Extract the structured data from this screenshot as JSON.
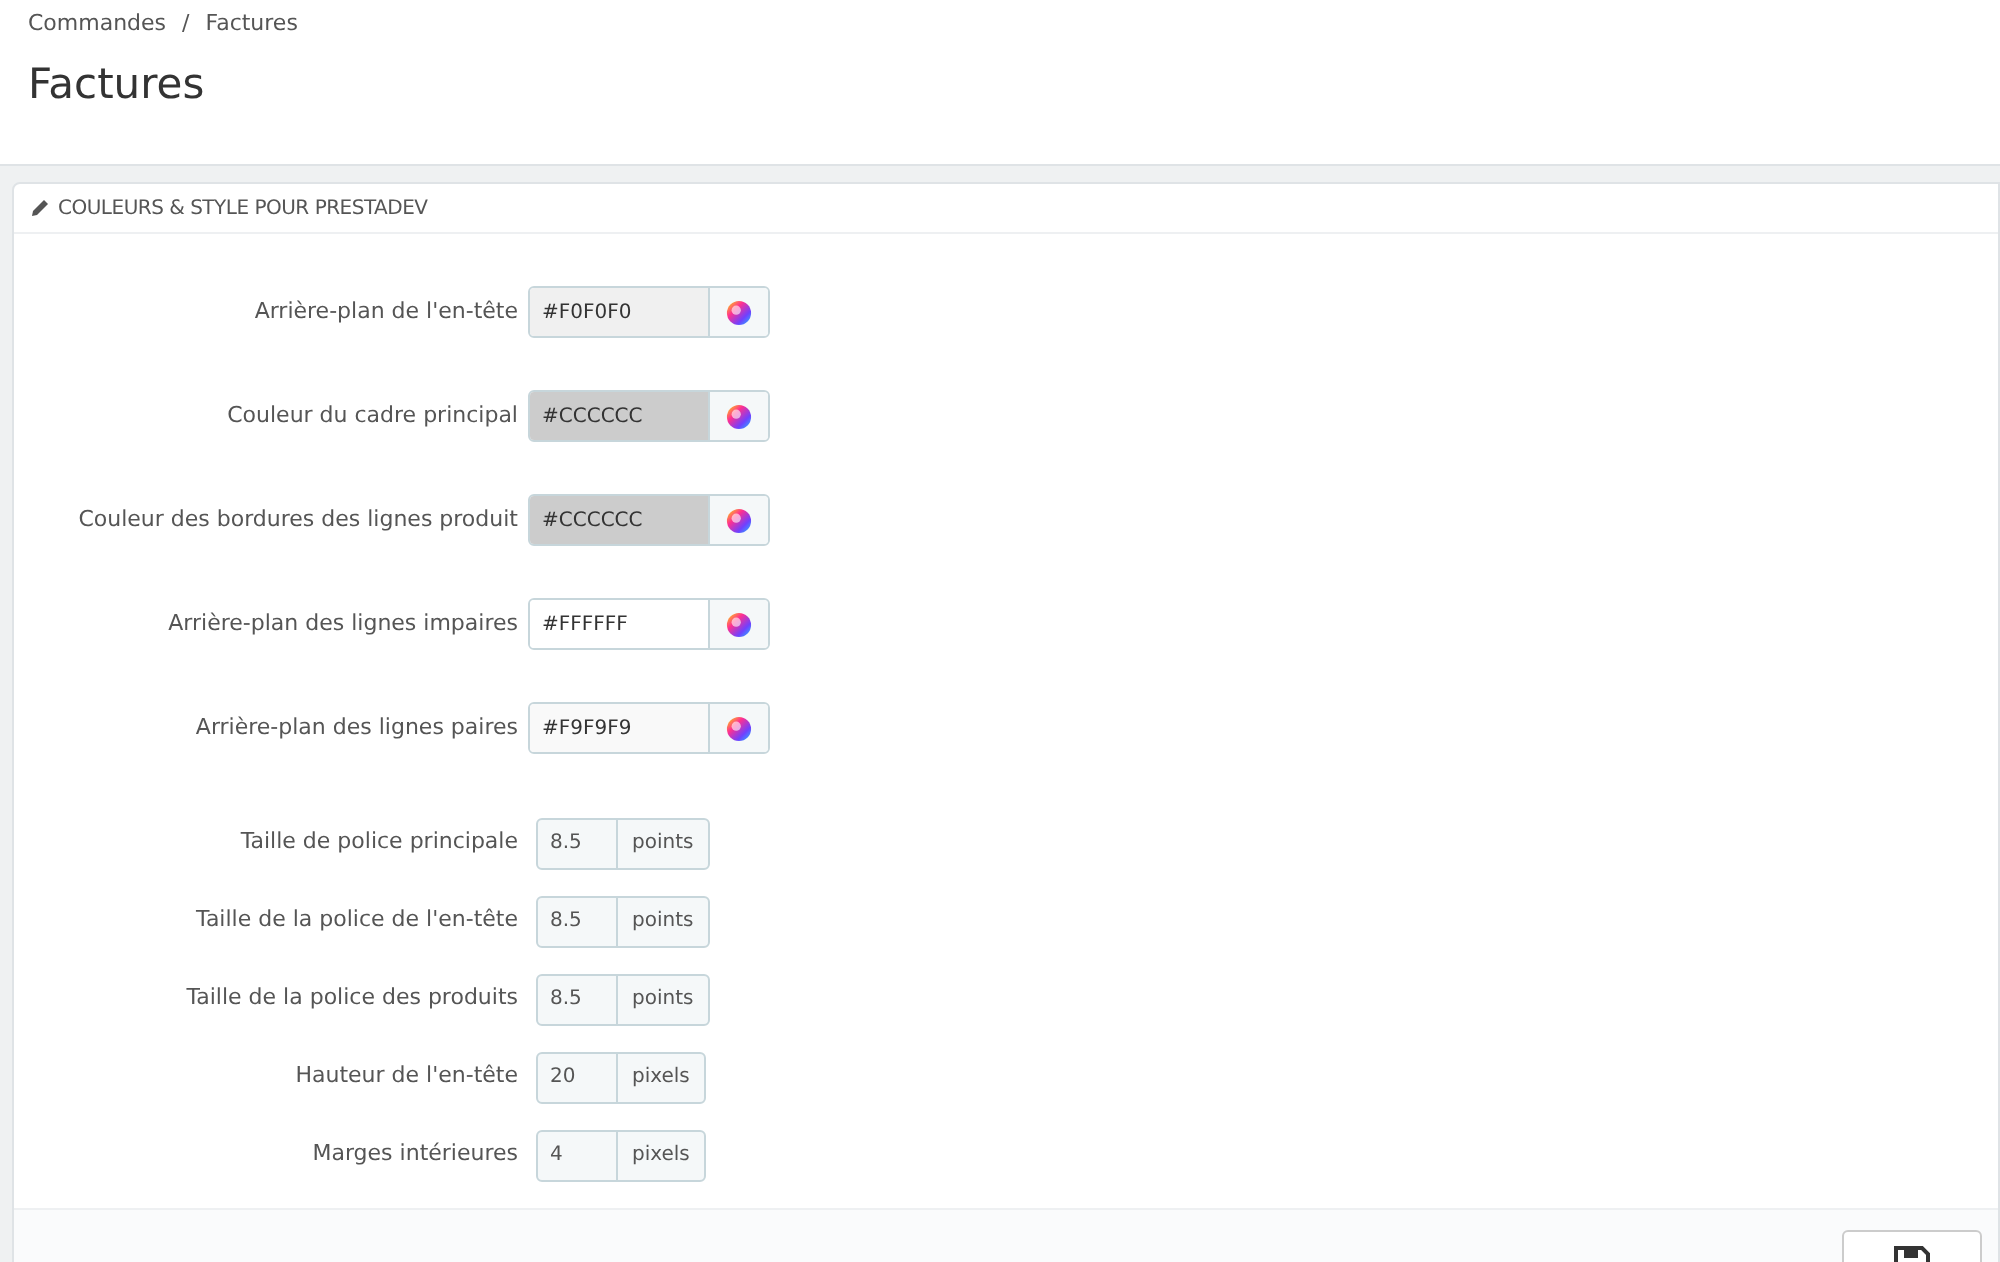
{
  "breadcrumb": [
    "Commandes",
    "Factures"
  ],
  "breadcrumb_separator": "/",
  "page_title": "Factures",
  "panel": {
    "title": "COULEURS & STYLE POUR PRESTADEV",
    "fields": [
      {
        "kind": "color",
        "label": "Arrière-plan de l'en-tête",
        "value": "#F0F0F0"
      },
      {
        "kind": "color",
        "label": "Couleur du cadre principal",
        "value": "#CCCCCC"
      },
      {
        "kind": "color",
        "label": "Couleur des bordures des lignes produit",
        "value": "#CCCCCC"
      },
      {
        "kind": "color",
        "label": "Arrière-plan des lignes impaires",
        "value": "#FFFFFF"
      },
      {
        "kind": "color",
        "label": "Arrière-plan des lignes paires",
        "value": "#F9F9F9"
      },
      {
        "kind": "number",
        "label": "Taille de police principale",
        "value": "8.5",
        "unit": "points"
      },
      {
        "kind": "number",
        "label": "Taille de la police de l'en-tête",
        "value": "8.5",
        "unit": "points"
      },
      {
        "kind": "number",
        "label": "Taille de la police des produits",
        "value": "8.5",
        "unit": "points"
      },
      {
        "kind": "number",
        "label": "Hauteur de l'en-tête",
        "value": "20",
        "unit": "pixels"
      },
      {
        "kind": "number",
        "label": "Marges intérieures",
        "value": "4",
        "unit": "pixels"
      }
    ]
  }
}
